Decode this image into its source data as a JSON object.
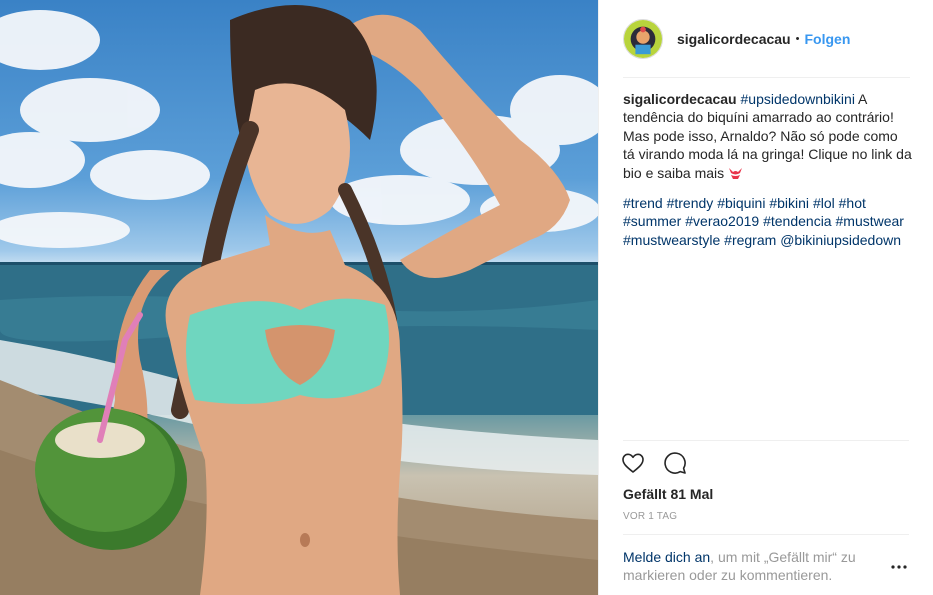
{
  "header": {
    "username": "sigalicordecacau",
    "separator": "•",
    "follow_label": "Folgen"
  },
  "caption": {
    "username": "sigalicordecacau",
    "first_tag": "#upsidedownbikini",
    "text": " A tendência do biquíni amarrado ao contrário! Mas pode isso, Arnaldo? Não só pode como tá virando moda lá na gringa! Clique no link da bio e saiba mais ",
    "emoji": "bikini-emoji",
    "hashtags": [
      "#trend",
      "#trendy",
      "#biquini",
      "#bikini",
      "#lol",
      "#hot",
      "#summer",
      "#verao2019",
      "#tendencia",
      "#mustwear",
      "#mustwearstyle",
      "#regram"
    ],
    "mention": "@bikiniupsidedown"
  },
  "actions": {
    "like_icon": "heart-icon",
    "comment_icon": "comment-icon"
  },
  "likes": "Gefällt 81 Mal",
  "timestamp": "VOR 1 TAG",
  "login_prompt": {
    "link_text": "Melde dich an",
    "rest_text": ", um mit „Gefällt mir“ zu markieren oder zu kommentieren."
  },
  "more_icon": "more-options-icon",
  "colors": {
    "link_blue": "#3897f0",
    "tag_blue": "#003569",
    "text": "#262626",
    "muted": "#999999",
    "divider": "#efefef"
  }
}
